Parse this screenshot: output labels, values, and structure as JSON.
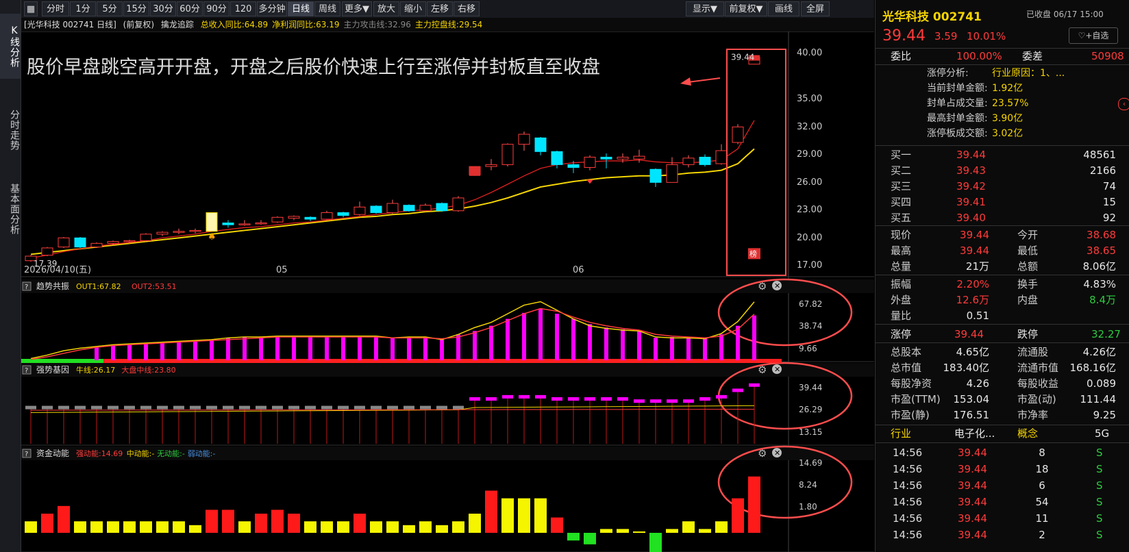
{
  "nav": {
    "left_tabs": [
      "K线分析",
      "分时走势",
      "基本面分析"
    ]
  },
  "toolbar": {
    "periods": [
      "分时",
      "1分",
      "5分",
      "15分",
      "30分",
      "60分",
      "90分",
      "120分",
      "多分钟",
      "日线",
      "周线",
      "更多▼",
      "放大",
      "缩小",
      "左移",
      "右移"
    ],
    "right": [
      "显示▼",
      "前复权▼",
      "画线",
      "全屏"
    ],
    "active": "日线"
  },
  "main": {
    "header": [
      "[光华科技 002741 日线]",
      "(前复权)",
      "擒龙追踪"
    ],
    "header_metrics": [
      {
        "text": "总收入同比:64.89",
        "color": "#f5d500"
      },
      {
        "text": "净利润同比:63.19",
        "color": "#f5d500"
      },
      {
        "text": "主力攻击线:32.96",
        "color": "#888888"
      },
      {
        "text": "主力控盘线:29.54",
        "color": "#f5d500"
      }
    ],
    "annotation": "股价早盘跳空高开开盘，开盘之后股价快速上行至涨停并封板直至收盘",
    "price_axis": [
      "40.00",
      "35.00",
      "32.00",
      "29.00",
      "26.00",
      "23.00",
      "20.00",
      "17.00"
    ],
    "high_label": "39.44",
    "low_label": "17.39",
    "date_labels": [
      "2026/04/10(五)",
      "05",
      "06"
    ],
    "bang_label": "榜"
  },
  "indicators": [
    {
      "name": "趋势共振",
      "lines": [
        {
          "text": "OUT1:67.82",
          "color": "#f5d500"
        },
        {
          "text": "OUT2:53.51",
          "color": "#ff3b3b"
        }
      ],
      "axis": [
        "67.82",
        "38.74",
        "9.66"
      ]
    },
    {
      "name": "强势基因",
      "lines": [
        {
          "text": "牛线:26.17",
          "color": "#f5d500"
        },
        {
          "text": "大盘中线:23.80",
          "color": "#ff3b3b"
        }
      ],
      "axis": [
        "39.44",
        "26.29",
        "13.15"
      ]
    },
    {
      "name": "资金动能",
      "lines": [
        {
          "text": "强动能:14.69",
          "color": "#ff3b3b"
        },
        {
          "text": "中动能:-",
          "color": "#f5d500"
        },
        {
          "text": "无动能:-",
          "color": "#2ecc40"
        },
        {
          "text": "弱动能:-",
          "color": "#4a90e2"
        }
      ],
      "axis": [
        "14.69",
        "8.24",
        "1.80"
      ]
    }
  ],
  "rpanel": {
    "title": "光华科技 002741",
    "status": "已收盘 06/17 15:00",
    "price": "39.44",
    "change": "3.59",
    "pct": "10.01%",
    "watch_btn": "+自选",
    "webi_label": "委比",
    "webi": "100.00%",
    "weicha_label": "委差",
    "weicha": "50908",
    "limit_info": [
      {
        "k": "涨停分析:",
        "v": "行业原因：1、..."
      },
      {
        "k": "当前封单金额:",
        "v": "1.92亿"
      },
      {
        "k": "封单占成交量:",
        "v": "23.57%"
      },
      {
        "k": "最高封单金额:",
        "v": "3.90亿"
      },
      {
        "k": "涨停板成交额:",
        "v": "3.02亿"
      }
    ],
    "bids": [
      {
        "label": "买一",
        "price": "39.44",
        "vol": "48561"
      },
      {
        "label": "买二",
        "price": "39.43",
        "vol": "2166"
      },
      {
        "label": "买三",
        "price": "39.42",
        "vol": "74"
      },
      {
        "label": "买四",
        "price": "39.41",
        "vol": "15"
      },
      {
        "label": "买五",
        "price": "39.40",
        "vol": "92"
      }
    ],
    "stats1": [
      [
        "现价",
        "39.44",
        "今开",
        "38.68"
      ],
      [
        "最高",
        "39.44",
        "最低",
        "38.65"
      ],
      [
        "总量",
        "21万",
        "总额",
        "8.06亿"
      ]
    ],
    "stats2": [
      [
        "振幅",
        "2.20%",
        "换手",
        "4.83%"
      ],
      [
        "外盘",
        "12.6万",
        "内盘",
        "8.4万"
      ],
      [
        "量比",
        "0.51",
        "",
        ""
      ]
    ],
    "limits": [
      "涨停",
      "39.44",
      "跌停",
      "32.27"
    ],
    "stats3": [
      [
        "总股本",
        "4.65亿",
        "流通股",
        "4.26亿"
      ],
      [
        "总市值",
        "183.40亿",
        "流通市值",
        "168.16亿"
      ],
      [
        "每股净资",
        "4.26",
        "每股收益",
        "0.089"
      ],
      [
        "市盈(TTM)",
        "153.04",
        "市盈(动)",
        "111.44"
      ],
      [
        "市盈(静)",
        "176.51",
        "市净率",
        "9.25"
      ]
    ],
    "industry": [
      "行业",
      "电子化...",
      "概念",
      "5G"
    ],
    "ticks": [
      [
        "14:56",
        "39.44",
        "8",
        "S"
      ],
      [
        "14:56",
        "39.44",
        "18",
        "S"
      ],
      [
        "14:56",
        "39.44",
        "6",
        "S"
      ],
      [
        "14:56",
        "39.44",
        "54",
        "S"
      ],
      [
        "14:56",
        "39.44",
        "11",
        "S"
      ],
      [
        "14:56",
        "39.44",
        "2",
        "S"
      ]
    ]
  },
  "colors": {
    "up": "#ff3b3b",
    "down": "#00e5ff",
    "ma_yellow": "#f5d500",
    "ma_red": "#e02020",
    "magenta": "#ff00ff",
    "annotation_red": "#ff4d4d"
  },
  "chart_data": {
    "type": "candlestick",
    "ylim": [
      17,
      40
    ],
    "candles": [
      [
        17.4,
        17.9,
        17.3,
        18.0
      ],
      [
        18.0,
        18.8,
        17.9,
        18.9
      ],
      [
        18.9,
        19.9,
        18.8,
        20.0
      ],
      [
        19.9,
        18.9,
        18.8,
        20.0
      ],
      [
        18.9,
        19.3,
        18.8,
        19.4
      ],
      [
        19.3,
        19.5,
        19.1,
        19.6
      ],
      [
        19.5,
        19.6,
        19.2,
        19.7
      ],
      [
        19.6,
        20.3,
        19.5,
        20.4
      ],
      [
        20.3,
        20.5,
        20.1,
        20.6
      ],
      [
        20.5,
        20.6,
        20.3,
        20.9
      ],
      [
        20.6,
        20.7,
        20.4,
        20.9
      ],
      [
        20.7,
        22.6,
        20.6,
        22.6
      ],
      [
        21.5,
        21.3,
        21.0,
        21.8
      ],
      [
        21.3,
        21.4,
        21.2,
        21.8
      ],
      [
        21.4,
        21.5,
        21.3,
        21.8
      ],
      [
        21.6,
        22.1,
        21.5,
        22.2
      ],
      [
        22.0,
        22.2,
        21.8,
        22.3
      ],
      [
        22.1,
        21.9,
        21.7,
        22.2
      ],
      [
        21.9,
        22.6,
        21.8,
        22.8
      ],
      [
        22.6,
        22.3,
        22.1,
        22.7
      ],
      [
        22.4,
        23.2,
        22.3,
        23.8
      ],
      [
        23.3,
        22.6,
        22.5,
        23.4
      ],
      [
        22.6,
        23.6,
        22.5,
        24.0
      ],
      [
        23.4,
        22.8,
        22.7,
        23.5
      ],
      [
        22.8,
        23.4,
        22.7,
        23.6
      ],
      [
        23.6,
        22.8,
        22.7,
        23.7
      ],
      [
        22.8,
        24.2,
        22.7,
        24.4
      ],
      [
        26.7,
        27.6,
        26.6,
        27.6
      ],
      [
        27.6,
        27.8,
        27.2,
        28.4
      ],
      [
        27.8,
        30.0,
        27.6,
        30.1
      ],
      [
        30.0,
        31.1,
        29.3,
        31.4
      ],
      [
        30.7,
        29.2,
        28.8,
        30.8
      ],
      [
        29.2,
        27.8,
        27.4,
        29.3
      ],
      [
        27.8,
        27.5,
        26.9,
        28.2
      ],
      [
        27.5,
        28.6,
        27.2,
        28.8
      ],
      [
        28.6,
        28.4,
        27.4,
        29.0
      ],
      [
        28.4,
        28.6,
        28.0,
        29.0
      ],
      [
        28.4,
        28.7,
        28.0,
        29.4
      ],
      [
        27.3,
        25.9,
        25.4,
        27.4
      ],
      [
        25.9,
        27.8,
        25.9,
        28.6
      ],
      [
        27.8,
        28.5,
        27.5,
        28.8
      ],
      [
        28.6,
        27.8,
        27.6,
        28.9
      ],
      [
        27.9,
        29.3,
        27.8,
        30.0
      ],
      [
        30.2,
        31.9,
        30.0,
        32.2
      ],
      [
        38.68,
        39.44,
        38.65,
        39.44
      ]
    ],
    "ma_red": [
      17.7,
      18.0,
      18.4,
      18.7,
      19.0,
      19.2,
      19.4,
      19.6,
      19.9,
      20.1,
      20.3,
      20.6,
      20.8,
      21.0,
      21.1,
      21.3,
      21.5,
      21.6,
      21.8,
      22.0,
      22.2,
      22.4,
      22.6,
      22.8,
      22.9,
      23.1,
      23.4,
      24.0,
      24.8,
      25.7,
      26.6,
      27.4,
      27.8,
      28.0,
      28.1,
      28.2,
      28.2,
      28.3,
      28.1,
      28.0,
      28.0,
      28.1,
      28.3,
      29.5,
      32.6
    ],
    "ma_yellow": [
      18.1,
      18.3,
      18.5,
      18.7,
      18.9,
      19.1,
      19.3,
      19.5,
      19.7,
      19.9,
      20.1,
      20.3,
      20.5,
      20.7,
      20.9,
      21.1,
      21.3,
      21.5,
      21.7,
      21.9,
      22.1,
      22.2,
      22.4,
      22.5,
      22.7,
      22.8,
      23.0,
      23.3,
      23.7,
      24.2,
      24.8,
      25.4,
      25.7,
      26.0,
      26.2,
      26.4,
      26.5,
      26.6,
      26.6,
      26.7,
      26.9,
      27.0,
      27.2,
      27.9,
      29.5
    ],
    "trend_bars": [
      4,
      8,
      12,
      14,
      16,
      18,
      19,
      20,
      21,
      22,
      23,
      24,
      26,
      27,
      27,
      28,
      28,
      28,
      28,
      28,
      28,
      28,
      26,
      27,
      27,
      24,
      30,
      34,
      40,
      48,
      55,
      60,
      54,
      48,
      42,
      38,
      36,
      35,
      26,
      27,
      26,
      25,
      30,
      40,
      52
    ],
    "trend_out1": [
      2,
      6,
      11,
      14,
      16,
      18,
      19,
      20,
      21,
      22,
      23,
      24,
      26,
      27,
      27,
      28,
      28,
      28,
      28,
      28,
      28,
      28,
      26,
      27,
      27,
      24,
      30,
      38,
      44,
      54,
      64,
      68,
      58,
      48,
      40,
      37,
      35,
      34,
      27,
      26,
      26,
      25,
      31,
      45,
      67.82
    ],
    "trend_out2": [
      1,
      4,
      8,
      12,
      15,
      17,
      18,
      19,
      20,
      21,
      22,
      23,
      24,
      25,
      26,
      27,
      27,
      27,
      27,
      27,
      27,
      27,
      26,
      26,
      26,
      25,
      27,
      32,
      38,
      46,
      54,
      60,
      57,
      50,
      44,
      40,
      37,
      35,
      30,
      28,
      27,
      26,
      28,
      36,
      53.51
    ],
    "strong_bars": [
      29,
      29,
      29,
      29,
      29,
      29,
      29,
      29,
      29,
      29,
      29,
      29,
      29,
      29,
      29,
      29,
      29,
      29,
      29,
      29,
      29,
      29,
      29,
      29,
      29,
      29,
      29,
      33,
      33,
      34,
      34,
      34,
      33,
      33,
      33,
      33,
      33,
      32,
      32,
      32,
      32,
      33,
      34,
      37,
      39.44
    ],
    "fund_bars": [
      3,
      5,
      7,
      3,
      3,
      3,
      3,
      3,
      3,
      3,
      2,
      6,
      6,
      3,
      5,
      6,
      5,
      3,
      3,
      3,
      5,
      3,
      3,
      2,
      3,
      2,
      3,
      5,
      11,
      9,
      9,
      9,
      4,
      -2,
      -3,
      1,
      1,
      0,
      -5,
      1,
      3,
      1,
      3,
      9,
      14.69
    ]
  }
}
